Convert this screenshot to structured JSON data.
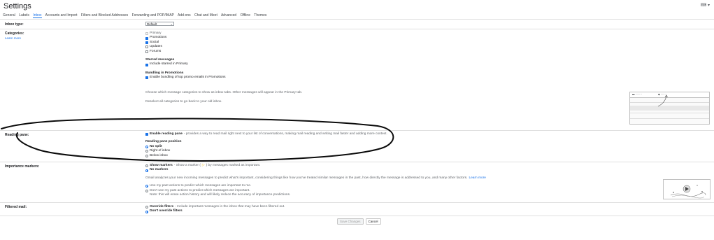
{
  "header": {
    "title": "Settings",
    "keyboard_icon": "keyboard-icon"
  },
  "tabs": [
    "General",
    "Labels",
    "Inbox",
    "Accounts and Import",
    "Filters and Blocked Addresses",
    "Forwarding and POP/IMAP",
    "Add-ons",
    "Chat and Meet",
    "Advanced",
    "Offline",
    "Themes"
  ],
  "active_tab": "Inbox",
  "inbox_type": {
    "label": "Inbox type:",
    "value": "Default"
  },
  "categories": {
    "label": "Categories:",
    "learn_more": "Learn more",
    "items": [
      {
        "label": "Primary",
        "checked": true,
        "disabled": true
      },
      {
        "label": "Promotions",
        "checked": true
      },
      {
        "label": "Social",
        "checked": true
      },
      {
        "label": "Updates",
        "checked": false
      },
      {
        "label": "Forums",
        "checked": false
      }
    ],
    "starred_title": "Starred messages",
    "starred_option": "Include starred in Primary",
    "bundling_title": "Bundling in Promotions",
    "bundling_option": "Enable bundling of top promo emails in Promotions",
    "help1": "Choose which message categories to show as inbox tabs. Other messages will appear in the Primary tab.",
    "help2": "Deselect all categories to go back to your old inbox."
  },
  "reading_pane": {
    "label": "Reading pane:",
    "enable_bold": "Enable reading pane",
    "enable_desc": " - provides a way to read mail right next to your list of conversations, making mail reading and writing mail faster and adding more context.",
    "position_title": "Reading pane position",
    "options": [
      "No split",
      "Right of inbox",
      "Below inbox"
    ],
    "selected": 0
  },
  "importance": {
    "label": "Importance markers:",
    "show_bold": "Show markers",
    "show_desc": " - Show a marker (",
    "show_desc2": ") by messages marked as important.",
    "no_markers": "No markers",
    "analysis": "Gmail analyzes your new incoming messages to predict what's important, considering things like how you've treated similar messages in the past, how directly the message is addressed to you, and many other factors.",
    "learn_more": "Learn more",
    "use_past": "Use my past actions to predict which messages are important to me.",
    "dont_use": "Don't use my past actions to predict which messages are important.",
    "note": "Note: this will erase action history and will likely reduce the accuracy of importance predictions."
  },
  "filtered": {
    "label": "Filtered mail:",
    "override_bold": "Override filters",
    "override_desc": " - Include important messages in the inbox that may have been filtered out.",
    "dont_override": "Don't override filters"
  },
  "actions": {
    "save": "Save Changes",
    "cancel": "Cancel"
  },
  "colors": {
    "accent": "#1a73e8",
    "marker": "#f6bf26"
  }
}
